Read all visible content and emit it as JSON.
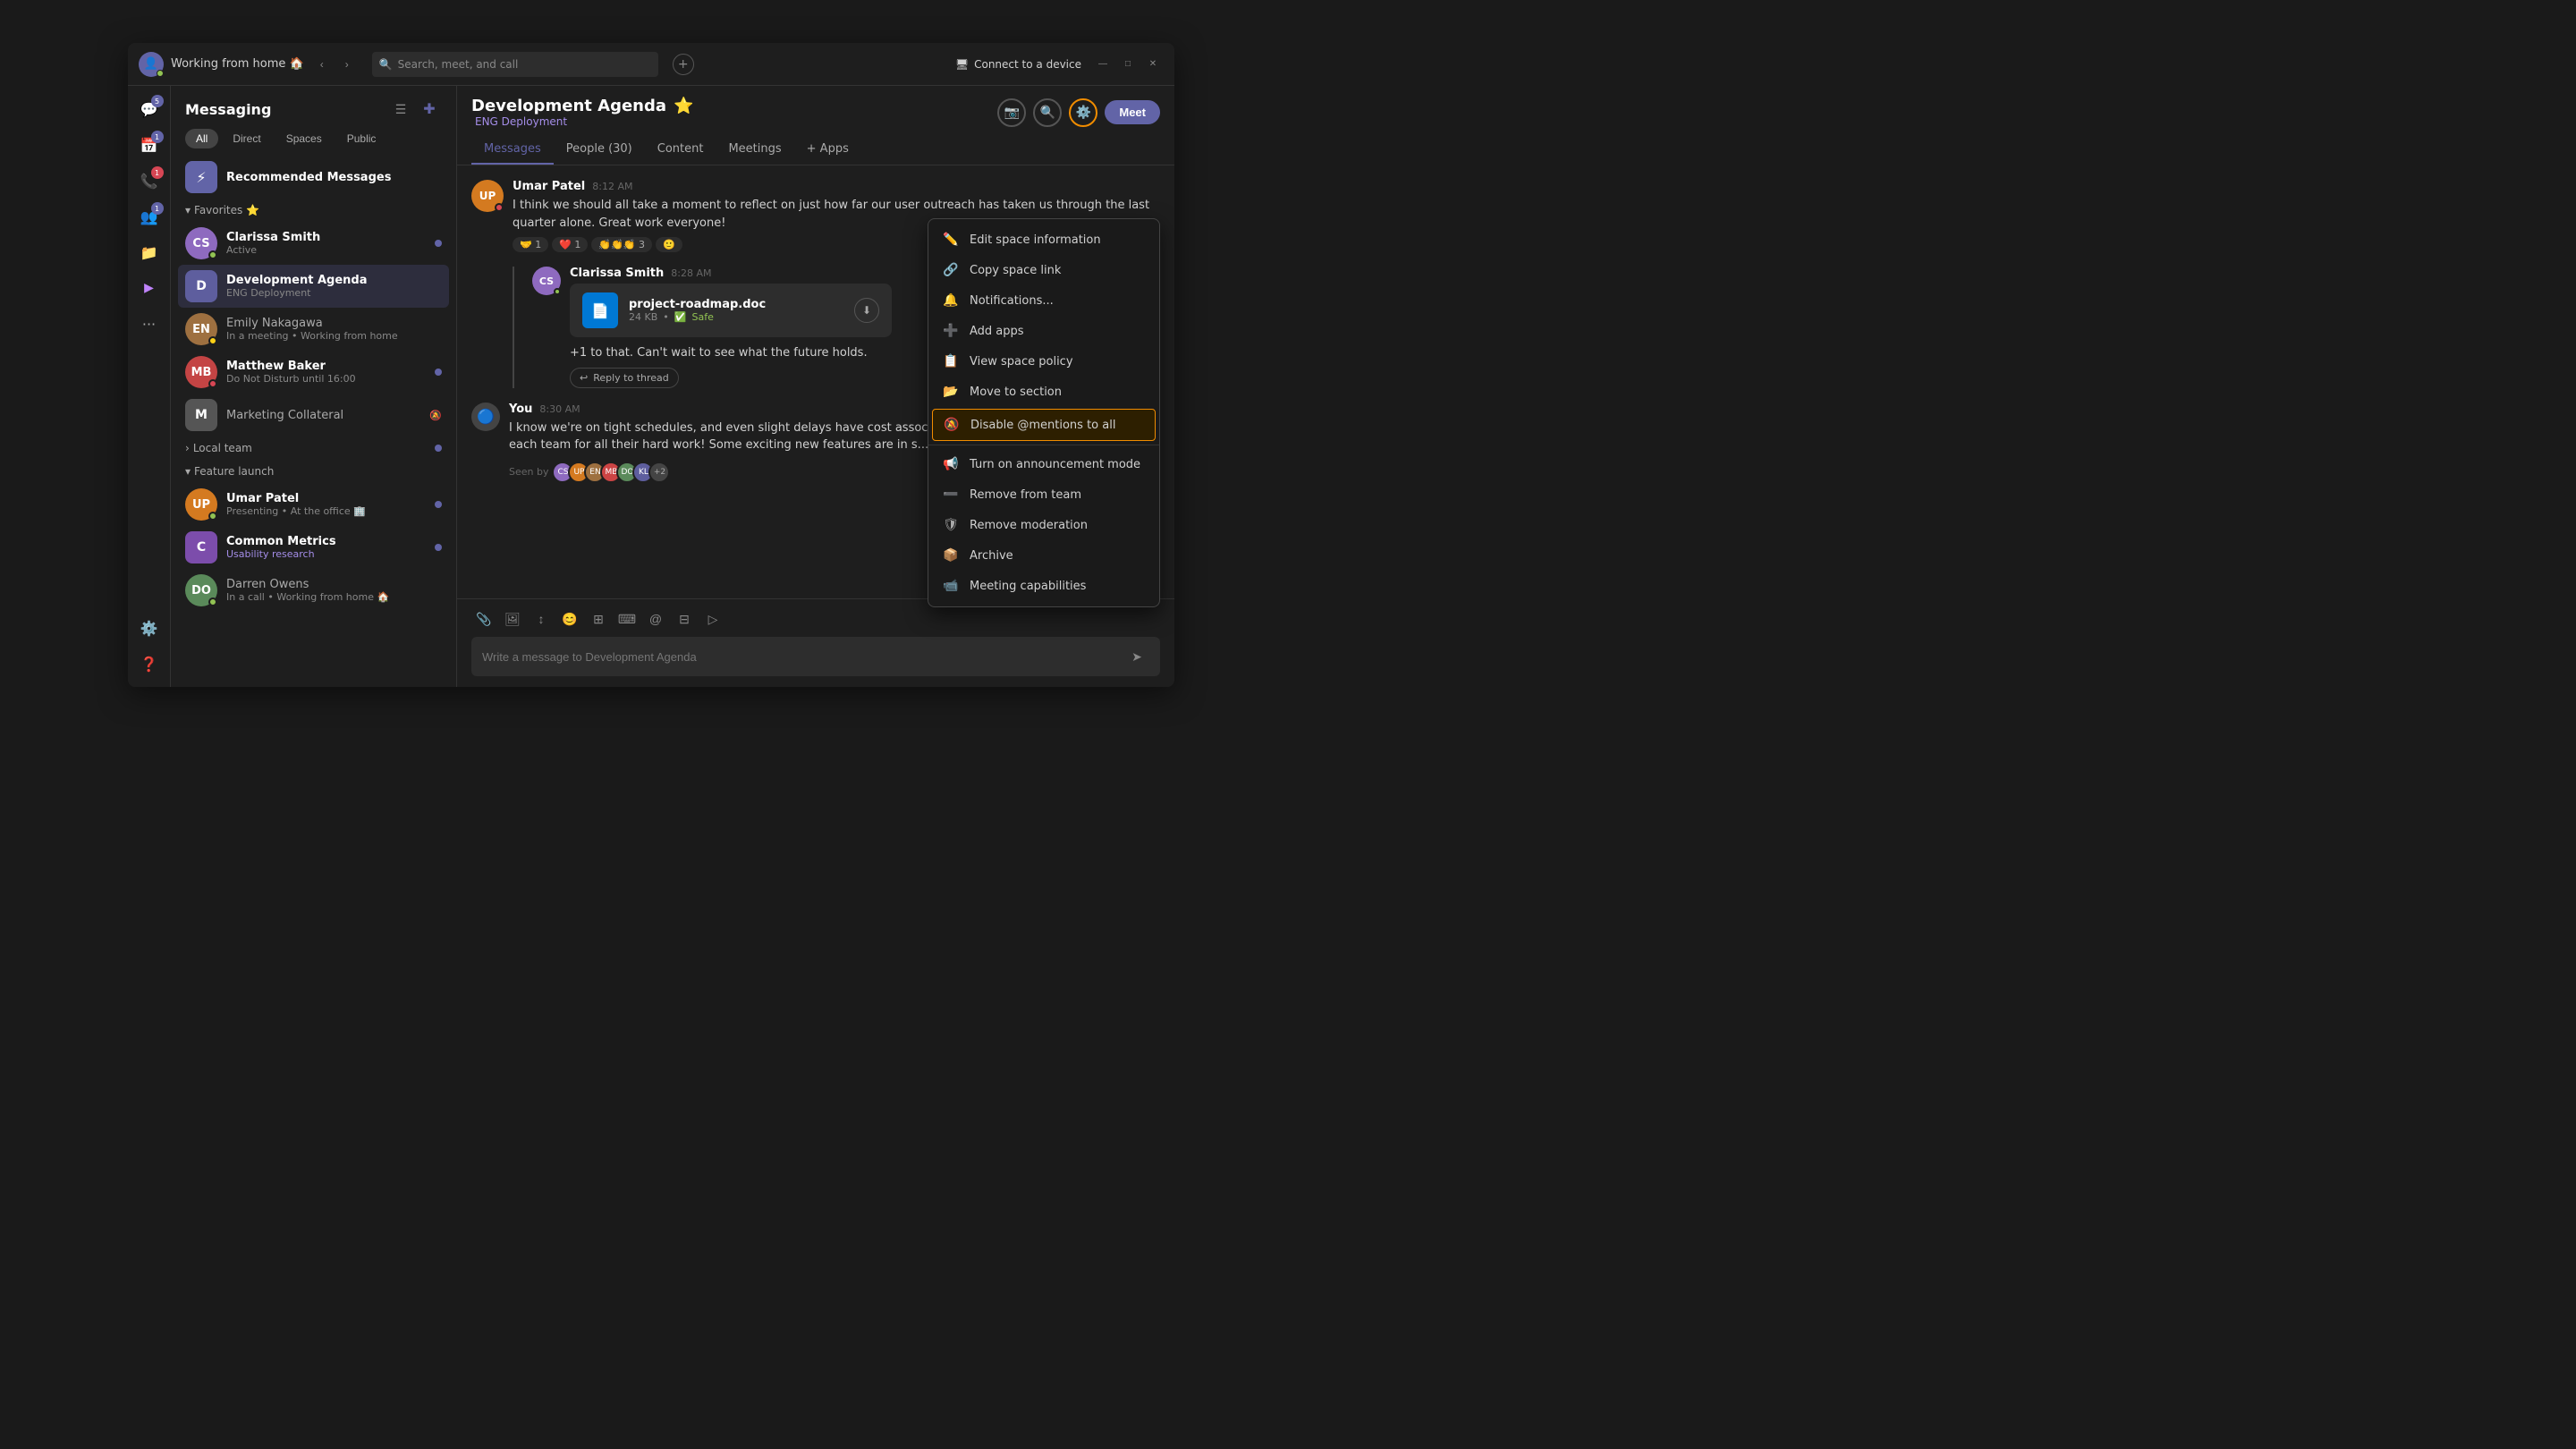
{
  "titlebar": {
    "workspace": "Working from home 🏠",
    "search_placeholder": "Search, meet, and call",
    "connect_label": "Connect to a device"
  },
  "sidebar": {
    "icons": [
      {
        "name": "chat-icon",
        "symbol": "💬",
        "badge": "5",
        "badge_type": "purple"
      },
      {
        "name": "calendar-icon",
        "symbol": "📅",
        "badge": "1",
        "badge_type": "purple"
      },
      {
        "name": "calls-icon",
        "symbol": "📞",
        "badge": "1",
        "badge_type": "red"
      },
      {
        "name": "people-icon",
        "symbol": "👥",
        "badge": "1",
        "badge_type": "purple"
      },
      {
        "name": "files-icon",
        "symbol": "📁"
      },
      {
        "name": "apps-icon",
        "symbol": "▶"
      },
      {
        "name": "more-icon",
        "symbol": "···"
      }
    ]
  },
  "messaging": {
    "title": "Messaging",
    "filters": [
      "All",
      "Direct",
      "Spaces",
      "Public"
    ],
    "active_filter": "All",
    "recommended": {
      "label": "Recommended Messages",
      "icon": "⚡"
    },
    "favorites_label": "Favorites ⭐",
    "contacts": [
      {
        "name": "Clarissa Smith",
        "sub": "Active",
        "avatar_bg": "#8e6abf",
        "initials": "CS",
        "status": "active",
        "bold": true,
        "unread": true
      },
      {
        "name": "Development Agenda",
        "sub": "ENG Deployment",
        "avatar_letter": "D",
        "avatar_bg": "#5e5e9e",
        "is_square": true,
        "active": true
      },
      {
        "name": "Emily Nakagawa",
        "sub": "In a meeting • Working from home",
        "avatar_bg": "#9e7040",
        "initials": "EN",
        "status": "away"
      },
      {
        "name": "Matthew Baker",
        "sub": "Do Not Disturb until 16:00",
        "avatar_bg": "#c44",
        "initials": "MB",
        "status": "dnd",
        "bold": true,
        "unread": true
      },
      {
        "name": "Marketing Collateral",
        "sub": "",
        "avatar_letter": "M",
        "avatar_bg": "#555",
        "is_square": true,
        "muted": true
      }
    ],
    "local_team": {
      "label": "Local team",
      "has_badge": true
    },
    "feature_launch": {
      "label": "Feature launch",
      "contacts": [
        {
          "name": "Umar Patel",
          "sub": "Presenting • At the office 🏢",
          "avatar_bg": "#d47a20",
          "initials": "UP",
          "status": "active",
          "bold": true,
          "unread": true
        },
        {
          "name": "Common Metrics",
          "sub": "Usability research",
          "avatar_letter": "C",
          "avatar_bg": "#7c4dab",
          "is_square": true,
          "bold": true,
          "unread": true,
          "sub_color": "purple"
        },
        {
          "name": "Darren Owens",
          "sub": "In a call • Working from home 🏠",
          "avatar_bg": "#5a8a5a",
          "initials": "DO",
          "status": "active"
        }
      ]
    }
  },
  "chat": {
    "title": "Development Agenda",
    "title_star": "⭐",
    "subtitle": "ENG Deployment",
    "tabs": [
      "Messages",
      "People (30)",
      "Content",
      "Meetings",
      "+ Apps"
    ],
    "active_tab": "Messages",
    "messages": [
      {
        "author": "Umar Patel",
        "time": "8:12 AM",
        "text": "I think we should all take a moment to reflect on just how far our user outreach has taken us through the last quarter alone. Great work everyone!",
        "avatar_bg": "#d47a20",
        "initials": "UP",
        "status": "dnd",
        "reactions": [
          {
            "emoji": "🤝",
            "count": "1"
          },
          {
            "emoji": "❤️",
            "count": "1"
          },
          {
            "emoji": "👏👏👏",
            "count": "3"
          },
          {
            "emoji": "🙂"
          }
        ]
      },
      {
        "author": "Clarissa Smith",
        "time": "8:28 AM",
        "text": "+1 to that. Can't wait to see what the future holds.",
        "avatar_bg": "#8e6abf",
        "initials": "CS",
        "status": "active",
        "file": {
          "name": "project-roadmap.doc",
          "size": "24 KB",
          "safe_label": "Safe",
          "icon": "📄"
        },
        "reply_thread": "Reply to thread"
      },
      {
        "author": "You",
        "time": "8:30 AM",
        "text": "I know we're on tight schedules, and even slight delays have cost associated with them. I want to thank you to each team for all their hard work! Some exciting new features are in s...",
        "is_you": true,
        "seen_by": {
          "label": "Seen by",
          "avatars": [
            {
              "bg": "#8e6abf",
              "initials": "CS"
            },
            {
              "bg": "#d47a20",
              "initials": "UP"
            },
            {
              "bg": "#9e7040",
              "initials": "EN"
            },
            {
              "bg": "#c44",
              "initials": "MB"
            },
            {
              "bg": "#5a8a5a",
              "initials": "DO"
            },
            {
              "bg": "#5e5e9e",
              "initials": "KL"
            }
          ],
          "more": "+2"
        }
      }
    ],
    "input_placeholder": "Write a message to Development Agenda",
    "toolbar_icons": [
      "📎",
      "🖼",
      "↕",
      "😊",
      "⊞",
      "⌨",
      "@",
      "⊟",
      "▷"
    ]
  },
  "context_menu": {
    "items": [
      {
        "icon": "✏️",
        "label": "Edit space information",
        "key": "edit_space"
      },
      {
        "icon": "🔗",
        "label": "Copy space link",
        "key": "copy_link"
      },
      {
        "icon": "🔔",
        "label": "Notifications...",
        "key": "notifications"
      },
      {
        "icon": "➕",
        "label": "Add apps",
        "key": "add_apps"
      },
      {
        "icon": "📋",
        "label": "View space policy",
        "key": "view_policy"
      },
      {
        "icon": "📂",
        "label": "Move to section",
        "key": "move_section"
      },
      {
        "icon": "🔕",
        "label": "Disable @mentions to all",
        "key": "disable_mentions",
        "highlighted": true
      },
      {
        "icon": "📢",
        "label": "Turn on announcement mode",
        "key": "announcement"
      },
      {
        "icon": "➖",
        "label": "Remove from team",
        "key": "remove_team"
      },
      {
        "icon": "🛡",
        "label": "Remove moderation",
        "key": "remove_mod"
      },
      {
        "icon": "📦",
        "label": "Archive",
        "key": "archive"
      },
      {
        "icon": "📹",
        "label": "Meeting capabilities",
        "key": "meeting_cap"
      }
    ]
  }
}
